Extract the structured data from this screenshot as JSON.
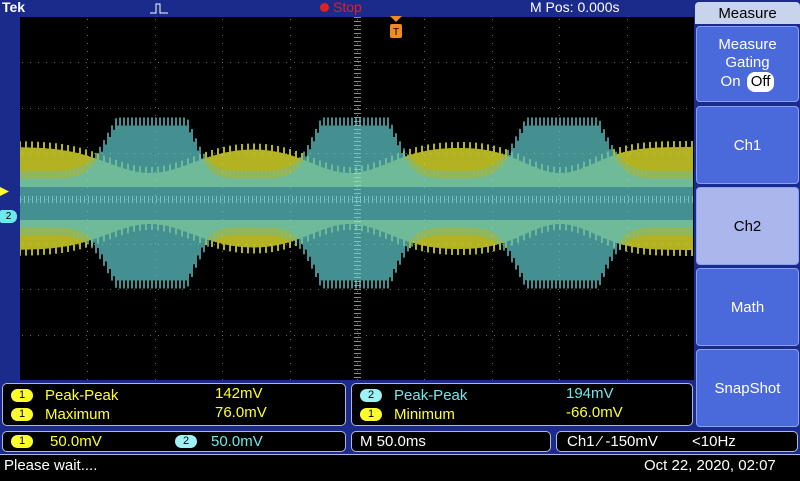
{
  "topbar": {
    "brand": "Tek",
    "status": "Stop",
    "position": "M Pos: 0.000s"
  },
  "markers": {
    "ch2": "2"
  },
  "menu": {
    "title": "Measure",
    "gating_label": "Measure Gating",
    "gating_on": "On",
    "gating_off": "Off",
    "buttons": [
      "Ch1",
      "Ch2",
      "Math",
      "SnapShot"
    ]
  },
  "measurements": {
    "left": [
      {
        "channel": "1",
        "label": "Peak-Peak",
        "value": "142mV"
      },
      {
        "channel": "1",
        "label": "Maximum",
        "value": "76.0mV"
      }
    ],
    "right": [
      {
        "channel": "2",
        "label": "Peak-Peak",
        "value": "194mV"
      },
      {
        "channel": "1",
        "label": "Minimum",
        "value": "-66.0mV"
      }
    ]
  },
  "status": {
    "ch1_badge": "1",
    "ch1_scale": "50.0mV",
    "ch2_badge": "2",
    "ch2_scale": "50.0mV",
    "timebase": "M 50.0ms",
    "trigger": "Ch1 ⁄ -150mV",
    "trigger_freq": "<10Hz"
  },
  "footer": {
    "message": "Please wait....",
    "datetime": "Oct 22, 2020, 02:07"
  },
  "colors": {
    "ch1": "#ffff30",
    "ch2": "#6fe8ea",
    "background": "#1a2b8c",
    "stop": "#e02020"
  }
}
